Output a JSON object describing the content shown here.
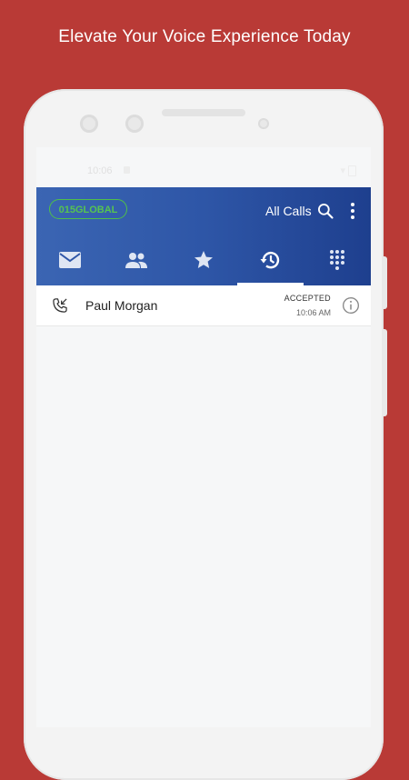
{
  "headline": "Elevate Your Voice Experience Today",
  "status_bar": {
    "time": "10:06"
  },
  "app": {
    "brand": "015GLOBAL",
    "filter_label": "All Calls",
    "colors": {
      "appbar": "#2e56a7",
      "brand_green": "#4fbf4a",
      "background": "#b93a36"
    }
  },
  "tabs": [
    {
      "icon": "mail-icon",
      "active": false
    },
    {
      "icon": "contacts-icon",
      "active": false
    },
    {
      "icon": "star-icon",
      "active": false
    },
    {
      "icon": "history-icon",
      "active": true
    },
    {
      "icon": "dialpad-icon",
      "active": false
    }
  ],
  "calls": [
    {
      "name": "Paul Morgan",
      "status": "ACCEPTED",
      "time": "10:06 AM",
      "icon": "incoming-call-icon"
    }
  ]
}
